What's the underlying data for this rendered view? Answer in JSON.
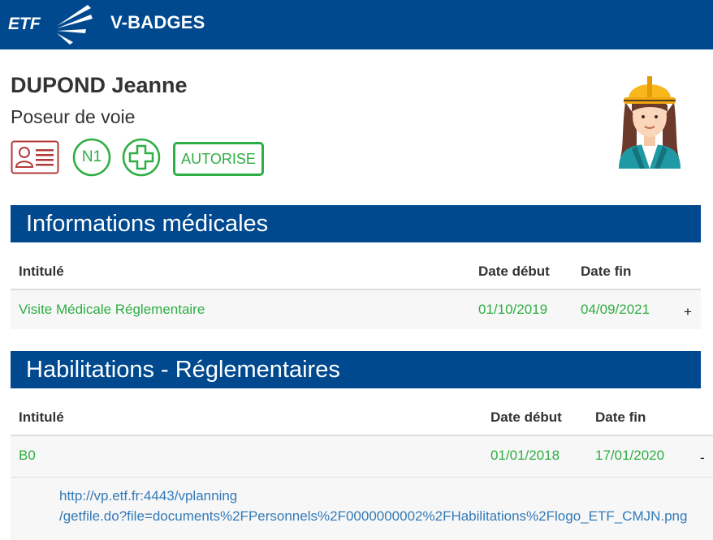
{
  "header": {
    "logo_text": "ETF",
    "app_title": "V-BADGES"
  },
  "person": {
    "name": "DUPOND Jeanne",
    "role": "Poseur de voie",
    "badges": {
      "card_icon": "id-card-icon",
      "level": "N1",
      "medical_icon": "medical-cross-icon",
      "status": "AUTORISE"
    },
    "avatar_icon": "construction-worker-avatar-icon"
  },
  "medical": {
    "title": "Informations médicales",
    "columns": [
      "Intitulé",
      "Date début",
      "Date fin"
    ],
    "rows": [
      {
        "label": "Visite Médicale Réglementaire",
        "start": "01/10/2019",
        "end": "04/09/2021",
        "toggle": "+"
      }
    ]
  },
  "habilitations": {
    "title": "Habilitations - Réglementaires",
    "columns": [
      "Intitulé",
      "Date début",
      "Date fin"
    ],
    "rows": [
      {
        "label": "B0",
        "start": "01/01/2018",
        "end": "17/01/2020",
        "toggle": "-",
        "link_line1": "http://vp.etf.fr:4443/vplanning",
        "link_line2": "/getfile.do?file=documents%2FPersonnels%2F0000000002%2FHabilitations%2Flogo_ETF_CMJN.png"
      }
    ]
  },
  "colors": {
    "primary": "#00498f",
    "success": "#2eae43",
    "danger": "#b33a3a",
    "link": "#337ab7"
  }
}
